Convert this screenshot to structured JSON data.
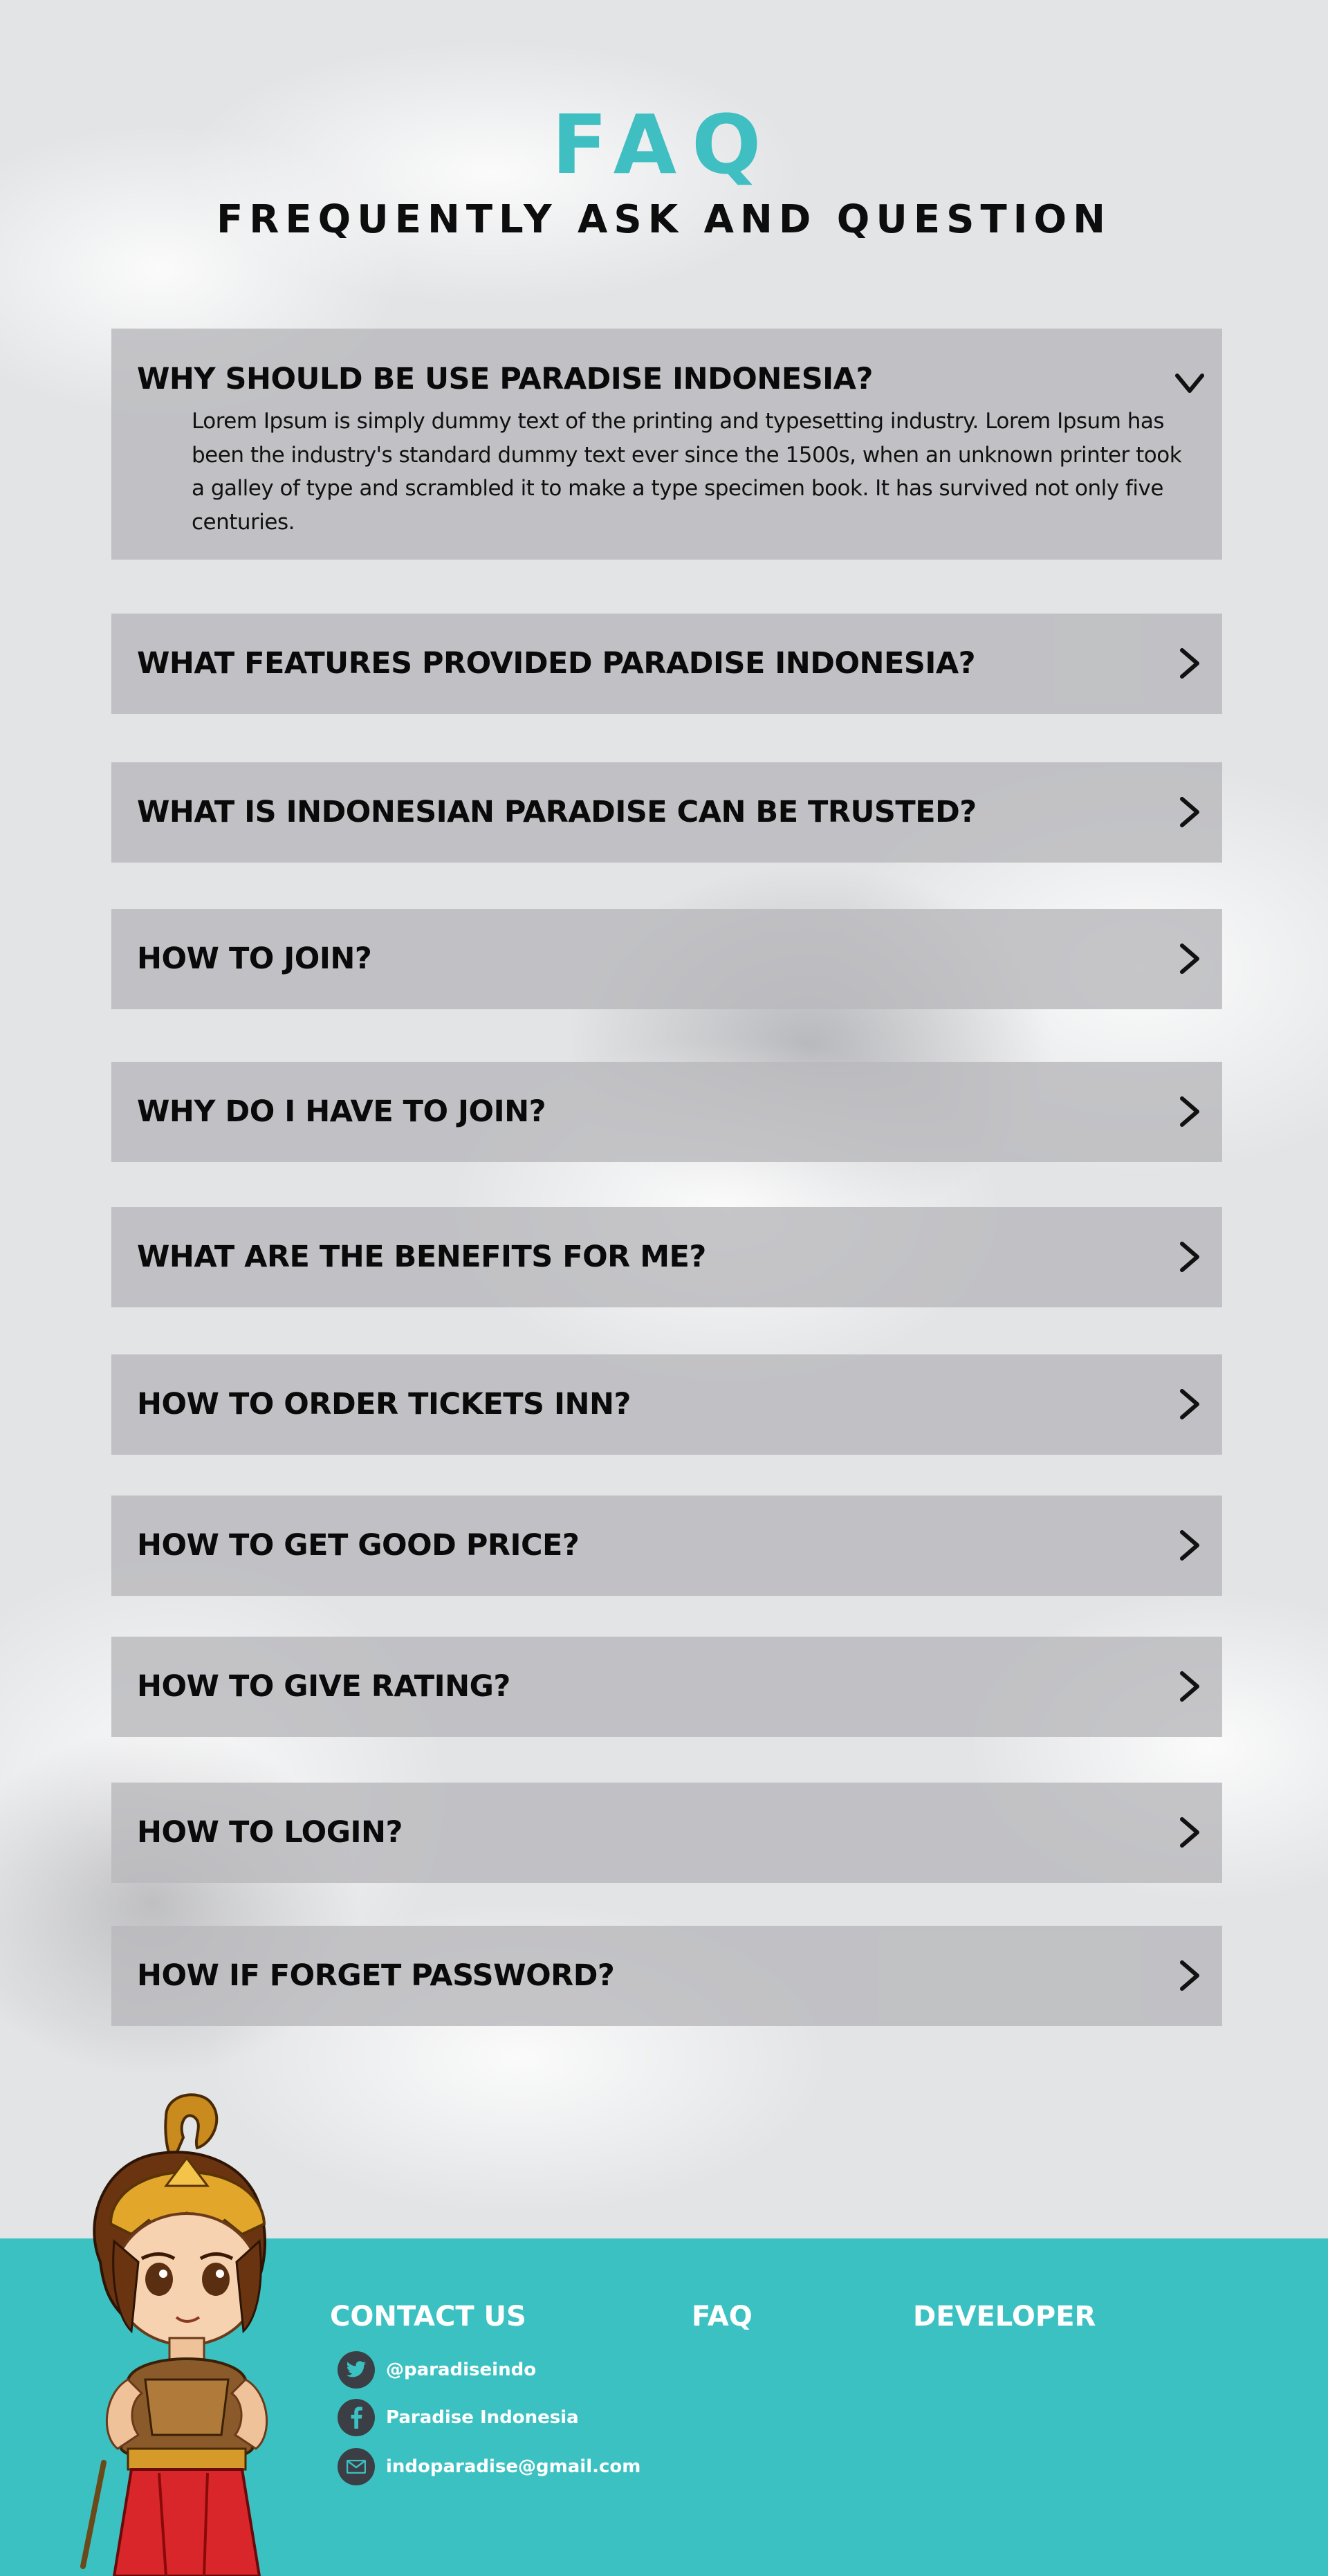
{
  "header": {
    "title": "FAQ",
    "subtitle": "FREQUENTLY ASK AND QUESTION"
  },
  "faqs": [
    {
      "question": "WHY SHOULD BE USE PARADISE INDONESIA?",
      "expanded": true,
      "answer": "Lorem Ipsum is simply dummy text of the printing and typesetting industry. Lorem Ipsum has been the industry's standard dummy text ever since the 1500s, when an unknown printer took a galley of type and scrambled it to make a type specimen book. It has survived not only five centuries."
    },
    {
      "question": "WHAT FEATURES PROVIDED PARADISE INDONESIA?",
      "expanded": false
    },
    {
      "question": "WHAT IS INDONESIAN PARADISE CAN BE TRUSTED?",
      "expanded": false
    },
    {
      "question": "HOW TO JOIN?",
      "expanded": false
    },
    {
      "question": "WHY DO I HAVE TO JOIN?",
      "expanded": false
    },
    {
      "question": "WHAT ARE THE BENEFITS FOR ME?",
      "expanded": false
    },
    {
      "question": "HOW TO ORDER TICKETS INN?",
      "expanded": false
    },
    {
      "question": "HOW TO GET GOOD PRICE?",
      "expanded": false
    },
    {
      "question": "HOW TO GIVE RATING?",
      "expanded": false
    },
    {
      "question": "HOW TO LOGIN?",
      "expanded": false
    },
    {
      "question": "HOW IF FORGET PASSWORD?",
      "expanded": false
    }
  ],
  "footer": {
    "contact_title": "CONTACT US",
    "faq_title": "FAQ",
    "developer_title": "DEVELOPER",
    "contacts": [
      {
        "icon": "twitter-icon",
        "text": "@paradiseindo"
      },
      {
        "icon": "facebook-icon",
        "text": "Paradise Indonesia"
      },
      {
        "icon": "mail-icon",
        "text": "indoparadise@gmail.com"
      }
    ]
  },
  "colors": {
    "accent": "#3fbfc1",
    "footer_bg": "#3cc1c2",
    "card_bg": "#b9babd",
    "page_bg": "#e3e4e6"
  }
}
